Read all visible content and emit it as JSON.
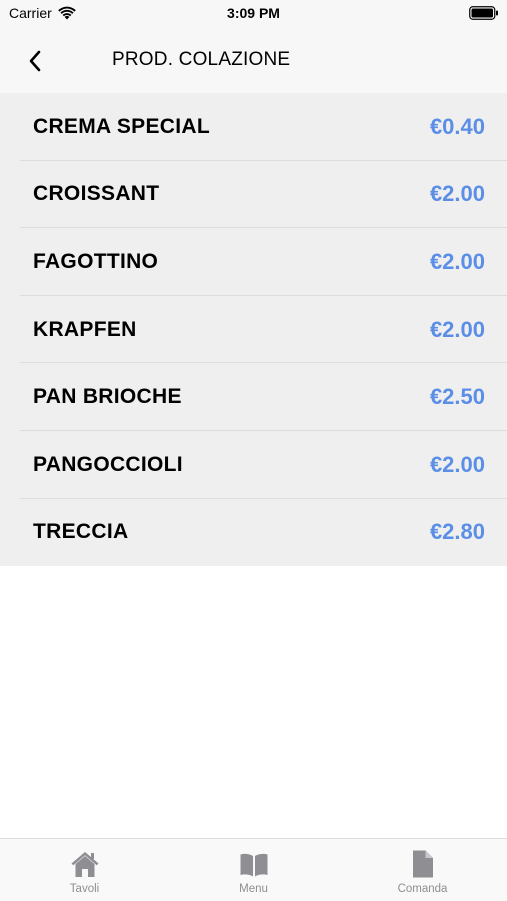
{
  "status_bar": {
    "carrier": "Carrier",
    "time": "3:09 PM",
    "wifi_icon": "wifi-icon",
    "battery_icon": "battery-icon"
  },
  "nav": {
    "back_icon": "chevron-left-icon",
    "title": "PROD. COLAZIONE"
  },
  "products": [
    {
      "name": "CREMA SPECIAL",
      "price": "€0.40"
    },
    {
      "name": "CROISSANT",
      "price": "€2.00"
    },
    {
      "name": "FAGOTTINO",
      "price": "€2.00"
    },
    {
      "name": "KRAPFEN",
      "price": "€2.00"
    },
    {
      "name": "PAN BRIOCHE",
      "price": "€2.50"
    },
    {
      "name": "PANGOCCIOLI",
      "price": "€2.00"
    },
    {
      "name": "TRECCIA",
      "price": "€2.80"
    }
  ],
  "tab_bar": {
    "tabs": [
      {
        "label": "Tavoli",
        "icon": "home-icon"
      },
      {
        "label": "Menu",
        "icon": "book-icon"
      },
      {
        "label": "Comanda",
        "icon": "document-icon"
      }
    ]
  },
  "colors": {
    "price": "#5b8ee6",
    "list_background": "#efefef",
    "tab_inactive": "#8e8e93"
  }
}
